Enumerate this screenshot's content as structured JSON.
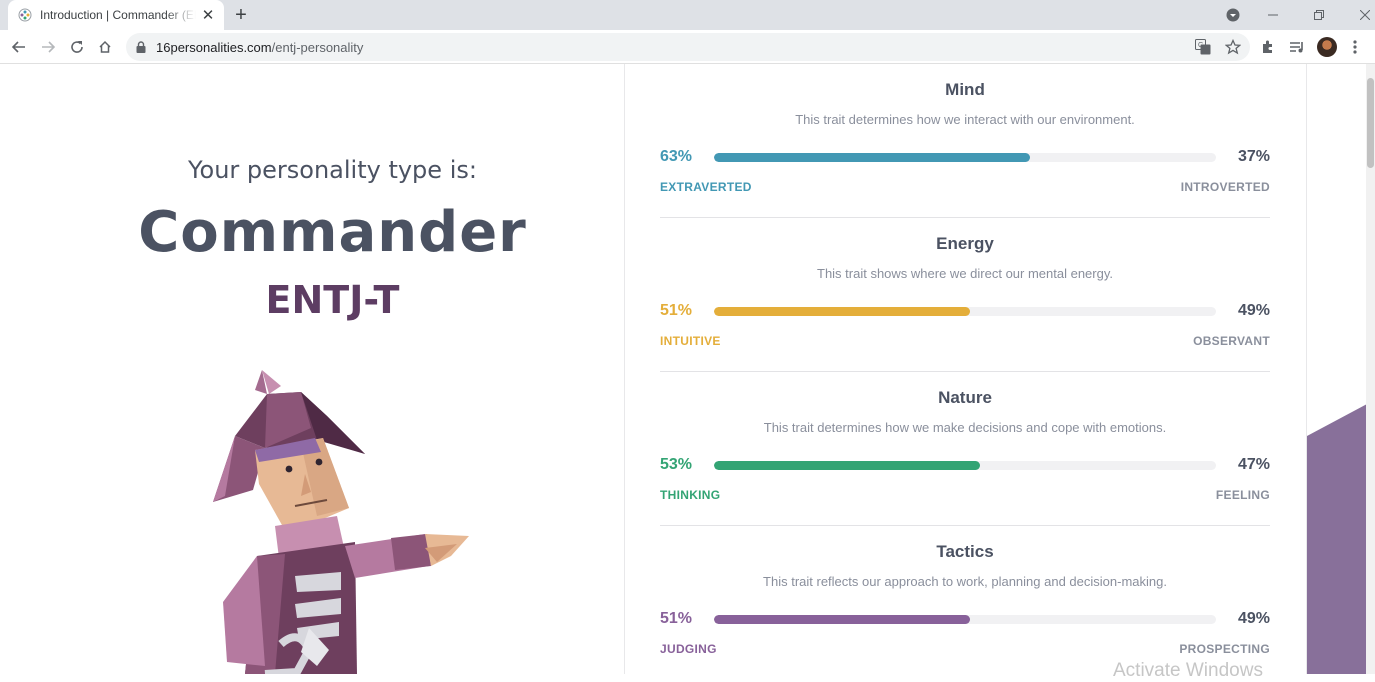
{
  "browser": {
    "tab_title": "Introduction | Commander (ENTJ",
    "tab_close": "✕",
    "new_tab": "+",
    "url_host": "16personalities.com",
    "url_path": "/entj-personality"
  },
  "hero": {
    "intro": "Your personality type is:",
    "type_name": "Commander",
    "type_code": "ENTJ-T"
  },
  "traits": [
    {
      "title": "Mind",
      "description": "This trait determines how we interact with our environment.",
      "left_pct": "63%",
      "right_pct": "37%",
      "left_label": "EXTRAVERTED",
      "right_label": "INTROVERTED",
      "fill": 0.63,
      "color": "#4298b4"
    },
    {
      "title": "Energy",
      "description": "This trait shows where we direct our mental energy.",
      "left_pct": "51%",
      "right_pct": "49%",
      "left_label": "INTUITIVE",
      "right_label": "OBSERVANT",
      "fill": 0.51,
      "color": "#e4ae3a"
    },
    {
      "title": "Nature",
      "description": "This trait determines how we make decisions and cope with emotions.",
      "left_pct": "53%",
      "right_pct": "47%",
      "left_label": "THINKING",
      "right_label": "FEELING",
      "fill": 0.53,
      "color": "#33a474"
    },
    {
      "title": "Tactics",
      "description": "This trait reflects our approach to work, planning and decision-making.",
      "left_pct": "51%",
      "right_pct": "49%",
      "left_label": "JUDGING",
      "right_label": "PROSPECTING",
      "fill": 0.51,
      "color": "#88619a"
    }
  ],
  "overlay": {
    "watermark": "Activate Windows"
  },
  "icons": [
    "favicon-icon",
    "close-icon",
    "plus-icon",
    "minimize-icon",
    "restore-icon",
    "window-close-icon",
    "back-icon",
    "forward-icon",
    "reload-icon",
    "home-icon",
    "lock-icon",
    "translate-icon",
    "star-icon",
    "extensions-icon",
    "media-icon",
    "profile-avatar",
    "menu-icon",
    "profile-dropdown-icon"
  ]
}
